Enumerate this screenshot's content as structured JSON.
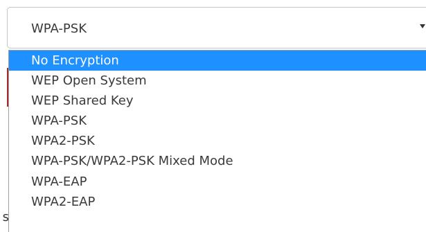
{
  "security_select": {
    "current_value": "WPA-PSK",
    "options": [
      "No Encryption",
      "WEP Open System",
      "WEP Shared Key",
      "WPA-PSK",
      "WPA2-PSK",
      "WPA-PSK/WPA2-PSK Mixed Mode",
      "WPA-EAP",
      "WPA2-EAP"
    ],
    "highlighted_option": "No Encryption",
    "highlight_color": "#1e90ff"
  },
  "background": {
    "partial_text": "s"
  }
}
